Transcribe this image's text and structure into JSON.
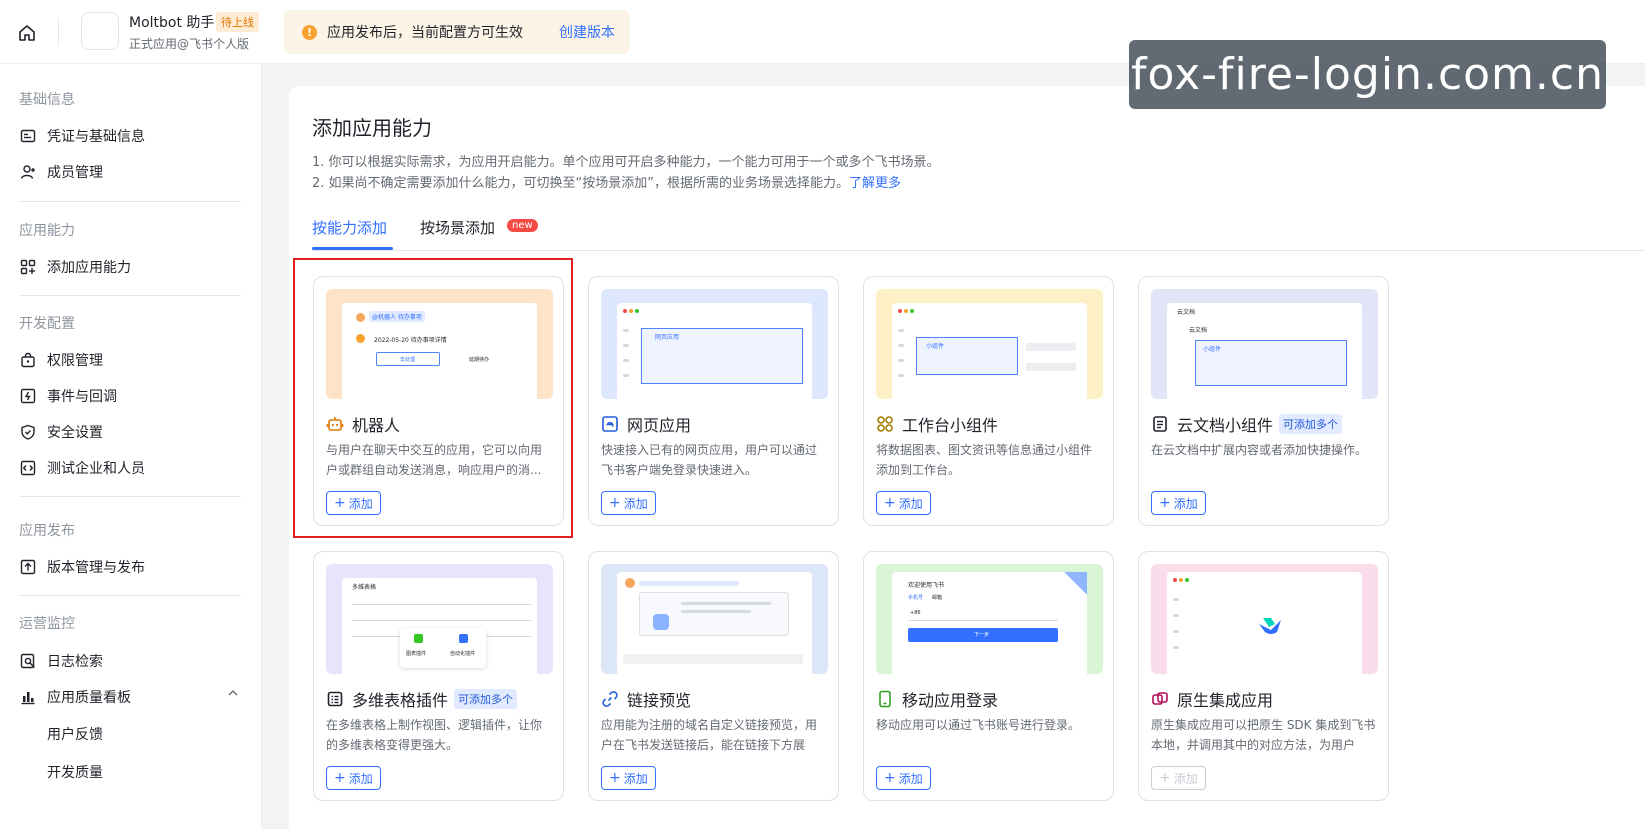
{
  "header": {
    "app_name": "Moltbot 助手",
    "status_badge": "待上线",
    "app_subtitle": "正式应用@飞书个人版",
    "notice_text": "应用发布后，当前配置方可生效",
    "notice_link": "创建版本"
  },
  "watermark": "fox-fire-login.com.cn",
  "sidebar": {
    "sections": [
      {
        "title": "基础信息",
        "items": [
          "凭证与基础信息",
          "成员管理"
        ]
      },
      {
        "title": "应用能力",
        "items": [
          "添加应用能力"
        ]
      },
      {
        "title": "开发配置",
        "items": [
          "权限管理",
          "事件与回调",
          "安全设置",
          "测试企业和人员"
        ]
      },
      {
        "title": "应用发布",
        "items": [
          "版本管理与发布"
        ]
      },
      {
        "title": "运营监控",
        "items": [
          "日志检索",
          "应用质量看板"
        ]
      }
    ],
    "sub_items": [
      "用户反馈",
      "开发质量"
    ]
  },
  "main": {
    "title": "添加应用能力",
    "desc1": "1. 你可以根据实际需求，为应用开启能力。单个应用可开启多种能力，一个能力可用于一个或多个飞书场景。",
    "desc2": "2. 如果尚不确定需要添加什么能力，可切换至“按场景添加”，根据所需的业务场景选择能力。",
    "desc2_link": "了解更多",
    "tabs": [
      "按能力添加",
      "按场景添加"
    ],
    "new_badge": "new",
    "add_label": "添加",
    "cards": [
      {
        "title": "机器人",
        "desc": "与用户在聊天中交互的应用，它可以向用户或群组自动发送消息，响应用户的消...",
        "icon": "robot-icon",
        "tag": ""
      },
      {
        "title": "网页应用",
        "desc": "快速接入已有的网页应用，用户可以通过飞书客户端免登录快速进入。",
        "icon": "web-app-icon",
        "tag": ""
      },
      {
        "title": "工作台小组件",
        "desc": "将数据图表、图文资讯等信息通过小组件添加到工作台。",
        "icon": "widget-icon",
        "tag": ""
      },
      {
        "title": "云文档小组件",
        "desc": "在云文档中扩展内容或者添加快捷操作。",
        "icon": "doc-icon",
        "tag": "可添加多个"
      },
      {
        "title": "多维表格插件",
        "desc": "在多维表格上制作视图、逻辑插件，让你的多维表格变得更强大。",
        "icon": "table-icon",
        "tag": "可添加多个"
      },
      {
        "title": "链接预览",
        "desc": "应用能为注册的域名自定义链接预览，用户在飞书发送链接后，能在链接下方展示...",
        "icon": "link-icon",
        "tag": ""
      },
      {
        "title": "移动应用登录",
        "desc": "移动应用可以通过飞书账号进行登录。",
        "icon": "mobile-icon",
        "tag": ""
      },
      {
        "title": "原生集成应用",
        "desc": "原生集成应用可以把原生 SDK 集成到飞书本地，并调用其中的对应方法，为用户提...",
        "icon": "native-icon",
        "tag": ""
      }
    ],
    "mock_text": {
      "robot_chip": "@机器人  待办事项",
      "robot_date": "2022-05-20 待办事项详情",
      "robot_btn1": "去处理",
      "robot_btn2": "延期待办",
      "web_box": "网页应用",
      "widget_box": "小组件",
      "doc_title": "云文档",
      "doc_sub": "云文档",
      "doc_box": "小组件",
      "table_title": "多维表格",
      "table_p1": "图表插件",
      "table_p2": "自动化插件",
      "mobile_title": "欢迎使用飞书",
      "mobile_tab1": "手机号",
      "mobile_tab2": "邮箱",
      "mobile_code": "+86",
      "mobile_btn": "下一步"
    }
  }
}
